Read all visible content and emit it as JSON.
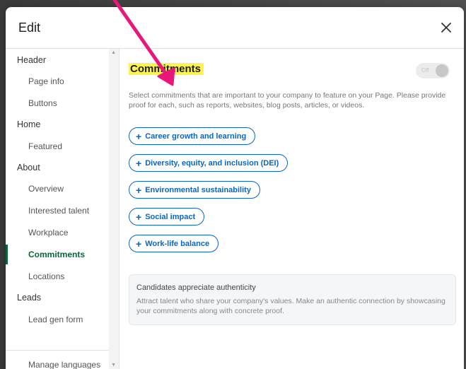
{
  "modal": {
    "title": "Edit"
  },
  "sidebar": {
    "items": [
      {
        "label": "Header",
        "level": "section"
      },
      {
        "label": "Page info",
        "level": "child"
      },
      {
        "label": "Buttons",
        "level": "child"
      },
      {
        "label": "Home",
        "level": "section"
      },
      {
        "label": "Featured",
        "level": "child"
      },
      {
        "label": "About",
        "level": "section"
      },
      {
        "label": "Overview",
        "level": "child"
      },
      {
        "label": "Interested talent",
        "level": "child"
      },
      {
        "label": "Workplace",
        "level": "child"
      },
      {
        "label": "Commitments",
        "level": "child",
        "active": true
      },
      {
        "label": "Locations",
        "level": "child"
      },
      {
        "label": "Leads",
        "level": "section"
      },
      {
        "label": "Lead gen form",
        "level": "child"
      },
      {
        "label": "Manage languages",
        "level": "child"
      }
    ]
  },
  "content": {
    "heading": "Commitments",
    "toggle_label": "Off",
    "toggle_on": false,
    "description": "Select commitments that are important to your company to feature on your Page. Please provide proof for each, such as reports, websites, blog posts, articles, or videos.",
    "commitments": [
      "Career growth and learning",
      "Diversity, equity, and inclusion (DEI)",
      "Environmental sustainability",
      "Social impact",
      "Work-life balance"
    ],
    "info": {
      "title": "Candidates appreciate authenticity",
      "body": "Attract talent who share your company's values. Make an authentic connection by showcasing your commitments along with concrete proof."
    }
  },
  "colors": {
    "accent": "#0a66c2",
    "active_nav": "#0a6638",
    "highlight": "#fff44f",
    "annotation_arrow": "#e6197a"
  }
}
